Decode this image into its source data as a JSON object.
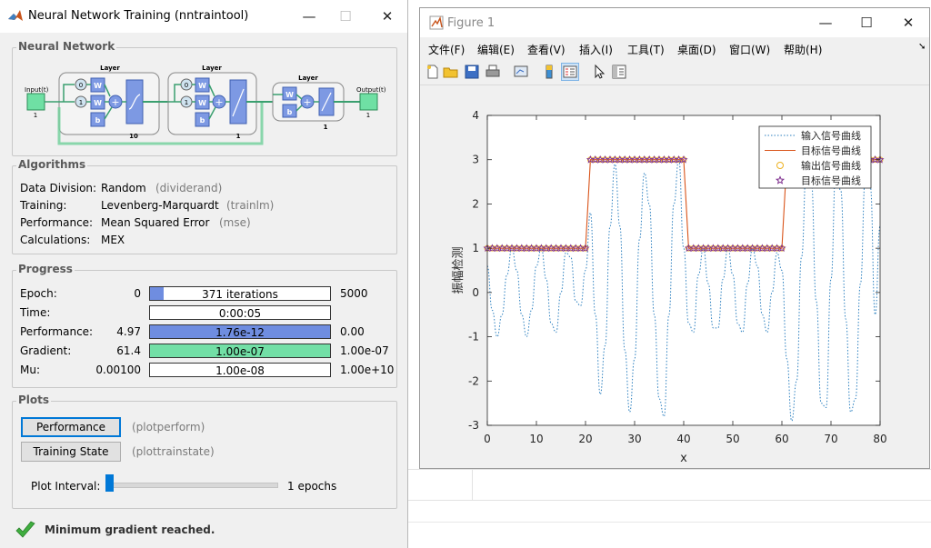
{
  "nntraintool": {
    "title": "Neural Network Training (nntraintool)",
    "sections": {
      "network": "Neural Network",
      "algorithms": "Algorithms",
      "progress": "Progress",
      "plots": "Plots"
    },
    "diagram": {
      "input_label": "Input(t)",
      "input_size": "1",
      "layer_label": "Layer",
      "output_label": "Output(t)",
      "output_size": "1",
      "layer1_size": "10",
      "layer2_size": "1",
      "layer3_size": "1",
      "delay0": "0",
      "delay1": "1",
      "w": "W",
      "b": "b"
    },
    "algorithms": [
      {
        "label": "Data Division:",
        "value": "Random",
        "func": "(dividerand)"
      },
      {
        "label": "Training:",
        "value": "Levenberg-Marquardt",
        "func": "(trainlm)"
      },
      {
        "label": "Performance:",
        "value": "Mean Squared Error",
        "func": "(mse)"
      },
      {
        "label": "Calculations:",
        "value": "MEX",
        "func": ""
      }
    ],
    "progress": [
      {
        "label": "Epoch:",
        "start": "0",
        "bar": "371 iterations",
        "end": "5000",
        "fill": 0.074,
        "color": "#6f8de0"
      },
      {
        "label": "Time:",
        "start": "",
        "bar": "0:00:05",
        "end": "",
        "fill": 0,
        "color": "#6f8de0"
      },
      {
        "label": "Performance:",
        "start": "4.97",
        "bar": "1.76e-12",
        "end": "0.00",
        "fill": 1,
        "color": "#6f8de0"
      },
      {
        "label": "Gradient:",
        "start": "61.4",
        "bar": "1.00e-07",
        "end": "1.00e-07",
        "fill": 1,
        "color": "#72dfa6"
      },
      {
        "label": "Mu:",
        "start": "0.00100",
        "bar": "1.00e-08",
        "end": "1.00e+10",
        "fill": 0,
        "color": "#6f8de0"
      }
    ],
    "plots": {
      "buttons": [
        {
          "label": "Performance",
          "func": "(plotperform)"
        },
        {
          "label": "Training State",
          "func": "(plottrainstate)"
        }
      ],
      "interval_label": "Plot Interval:",
      "interval_value": "1 epochs"
    },
    "status": "Minimum gradient reached."
  },
  "figure": {
    "title": "Figure 1",
    "menus": [
      "文件(F)",
      "编辑(E)",
      "查看(V)",
      "插入(I)",
      "工具(T)",
      "桌面(D)",
      "窗口(W)",
      "帮助(H)"
    ],
    "toolbar_icons": [
      "new-file-icon",
      "open-folder-icon",
      "save-icon",
      "print-icon",
      "link-plot-icon",
      "colorbar-icon",
      "legend-icon",
      "pointer-icon",
      "property-editor-icon"
    ]
  },
  "chart_data": {
    "type": "line",
    "title": "",
    "xlabel": "x",
    "ylabel": "振幅检测",
    "xlim": [
      0,
      80
    ],
    "ylim": [
      -3,
      4
    ],
    "xticks": [
      "0",
      "10",
      "20",
      "30",
      "40",
      "50",
      "60",
      "70",
      "80"
    ],
    "yticks": [
      "-3",
      "-2",
      "-1",
      "0",
      "1",
      "2",
      "3",
      "4"
    ],
    "legend_position": "top-right",
    "legend": [
      "输入信号曲线",
      "目标信号曲线",
      "输出信号曲线",
      "目标信号曲线"
    ],
    "target_segments": [
      {
        "x_start": 0,
        "x_end": 20,
        "y": 1
      },
      {
        "x_start": 21,
        "x_end": 40,
        "y": 3
      },
      {
        "x_start": 41,
        "x_end": 60,
        "y": 1
      },
      {
        "x_start": 61,
        "x_end": 80,
        "y": 3
      }
    ],
    "series": [
      {
        "name": "输入信号曲线",
        "style": "dotted",
        "color": "#2b7fbf",
        "x": [
          0,
          1,
          2,
          3,
          4,
          5,
          6,
          7,
          8,
          9,
          10,
          11,
          12,
          13,
          14,
          15,
          16,
          17,
          18,
          19,
          20,
          21,
          22,
          23,
          24,
          25,
          26,
          27,
          28,
          29,
          30,
          31,
          32,
          33,
          34,
          35,
          36,
          37,
          38,
          39,
          40,
          41,
          42,
          43,
          44,
          45,
          46,
          47,
          48,
          49,
          50,
          51,
          52,
          53,
          54,
          55,
          56,
          57,
          58,
          59,
          60,
          61,
          62,
          63,
          64,
          65,
          66,
          67,
          68,
          69,
          70,
          71,
          72,
          73,
          74,
          75,
          76,
          77,
          78,
          79,
          80
        ],
        "y": [
          0.6,
          -0.4,
          -1.0,
          -0.5,
          0.4,
          1.0,
          0.5,
          -0.5,
          -1.0,
          -0.4,
          0.6,
          1.0,
          0.3,
          -0.7,
          -0.9,
          0.0,
          0.9,
          0.8,
          -0.2,
          -0.3,
          0.5,
          1.8,
          -0.5,
          -2.3,
          -1.2,
          1.5,
          2.9,
          1.5,
          -1.3,
          -2.7,
          -1.5,
          1.2,
          2.7,
          2.0,
          -0.5,
          -2.4,
          -2.8,
          -0.5,
          2.0,
          3.0,
          1.0,
          -0.7,
          -0.9,
          0.4,
          1.0,
          0.2,
          -0.8,
          -0.8,
          0.3,
          1.0,
          0.4,
          -0.7,
          -0.9,
          0.2,
          1.0,
          0.6,
          -0.5,
          -0.9,
          0.0,
          0.9,
          0.5,
          -1.5,
          -2.9,
          -2.0,
          0.8,
          2.8,
          2.5,
          -0.2,
          -2.5,
          -2.6,
          0.3,
          2.8,
          2.3,
          -0.6,
          -2.7,
          -2.4,
          0.2,
          2.6,
          2.4,
          -0.5,
          1.5
        ]
      },
      {
        "name": "目标信号曲线",
        "style": "solid",
        "color": "#d9541a"
      },
      {
        "name": "输出信号曲线",
        "style": "marker-circle",
        "color": "#edb120"
      },
      {
        "name": "目标信号曲线",
        "style": "marker-star",
        "color": "#7e2f8e"
      }
    ]
  }
}
